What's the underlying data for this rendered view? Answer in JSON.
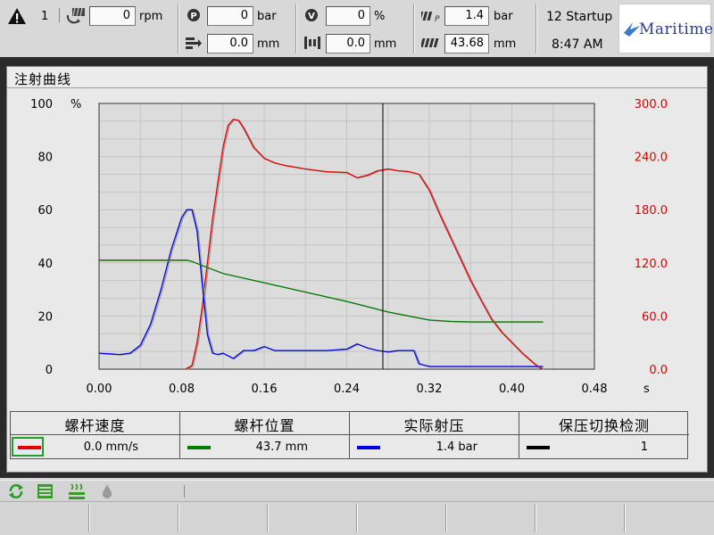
{
  "header": {
    "alarm_count": "1",
    "screw_rpm": {
      "value": "0",
      "unit": "rpm"
    },
    "pressure": {
      "value": "0",
      "unit": "bar"
    },
    "stroke": {
      "value": "0.0",
      "unit": "mm"
    },
    "valve_percent": {
      "value": "0",
      "unit": "%"
    },
    "mold_pos": {
      "value": "0.0",
      "unit": "mm"
    },
    "injection_pressure": {
      "value": "1.4",
      "unit": "bar"
    },
    "injection_pos": {
      "value": "43.68",
      "unit": "mm"
    },
    "machine_mode": "12 Startup",
    "time": "8:47 AM",
    "logo": "Maritime"
  },
  "panel": {
    "title": "注射曲线"
  },
  "chart_data": {
    "type": "line",
    "x_unit": "s",
    "xlim": [
      0.0,
      0.48
    ],
    "x_ticks": [
      "0.00",
      "0.08",
      "0.16",
      "0.24",
      "0.32",
      "0.40",
      "0.48"
    ],
    "left_axis": {
      "unit": "%",
      "ylim": [
        0,
        100
      ],
      "ticks": [
        "0",
        "20",
        "40",
        "60",
        "80",
        "100"
      ]
    },
    "right_axis": {
      "ylim": [
        0,
        300
      ],
      "ticks": [
        "0.0",
        "60.0",
        "120.0",
        "180.0",
        "240.0",
        "300.0"
      ],
      "color": "#e00000"
    },
    "grid": true,
    "cursor_x": 0.275,
    "series": [
      {
        "color": "#e00000",
        "axis": "right",
        "x": [
          0.084,
          0.09,
          0.095,
          0.1,
          0.11,
          0.12,
          0.125,
          0.13,
          0.135,
          0.14,
          0.15,
          0.16,
          0.17,
          0.18,
          0.2,
          0.22,
          0.24,
          0.25,
          0.26,
          0.27,
          0.28,
          0.29,
          0.3,
          0.31,
          0.32,
          0.33,
          0.34,
          0.35,
          0.36,
          0.37,
          0.38,
          0.39,
          0.4,
          0.41,
          0.42,
          0.425,
          0.43
        ],
        "y": [
          0,
          4,
          30,
          70,
          170,
          250,
          275,
          282,
          281,
          272,
          250,
          238,
          233,
          230,
          226,
          223,
          222,
          216,
          219,
          224,
          226,
          224,
          223,
          220,
          202,
          175,
          150,
          125,
          100,
          78,
          57,
          42,
          30,
          18,
          8,
          3,
          0
        ]
      },
      {
        "color": "#0000e0",
        "axis": "left",
        "x": [
          0.0,
          0.02,
          0.03,
          0.04,
          0.05,
          0.06,
          0.07,
          0.08,
          0.085,
          0.09,
          0.095,
          0.1,
          0.105,
          0.11,
          0.115,
          0.12,
          0.13,
          0.14,
          0.15,
          0.16,
          0.17,
          0.18,
          0.2,
          0.22,
          0.24,
          0.25,
          0.26,
          0.27,
          0.28,
          0.29,
          0.3,
          0.305,
          0.31,
          0.32,
          0.35,
          0.4,
          0.43
        ],
        "y": [
          6,
          5.5,
          6,
          9,
          17,
          30,
          45,
          57,
          60,
          60,
          52,
          32,
          13,
          6,
          5.5,
          6,
          4,
          7,
          7,
          8.5,
          7,
          7,
          7,
          7,
          7.5,
          9.5,
          8,
          7,
          6.5,
          7,
          7,
          7,
          2,
          1,
          1,
          1,
          1
        ]
      },
      {
        "color": "#007a00",
        "axis": "left",
        "x": [
          0.0,
          0.05,
          0.085,
          0.09,
          0.1,
          0.12,
          0.16,
          0.2,
          0.24,
          0.28,
          0.3,
          0.32,
          0.34,
          0.36,
          0.38,
          0.4,
          0.43
        ],
        "y": [
          41,
          41,
          41,
          40.5,
          39,
          36,
          32.5,
          29,
          25.5,
          21.5,
          20,
          18.5,
          18,
          17.8,
          17.8,
          17.8,
          17.8
        ]
      }
    ]
  },
  "legend": [
    {
      "label": "螺杆速度",
      "value": "0.0 mm/s",
      "color": "#e00000",
      "selected": true
    },
    {
      "label": "螺杆位置",
      "value": "43.7 mm",
      "color": "#007a00",
      "selected": false
    },
    {
      "label": "实际射压",
      "value": "1.4 bar",
      "color": "#0000e0",
      "selected": false
    },
    {
      "label": "保压切换检测",
      "value": "1",
      "color": "#000000",
      "selected": false
    }
  ],
  "status_bar": {
    "icons": [
      "cycle-icon",
      "stack-icon",
      "heater-icon",
      "drop-icon"
    ]
  },
  "softkeys": {
    "count": 8
  }
}
